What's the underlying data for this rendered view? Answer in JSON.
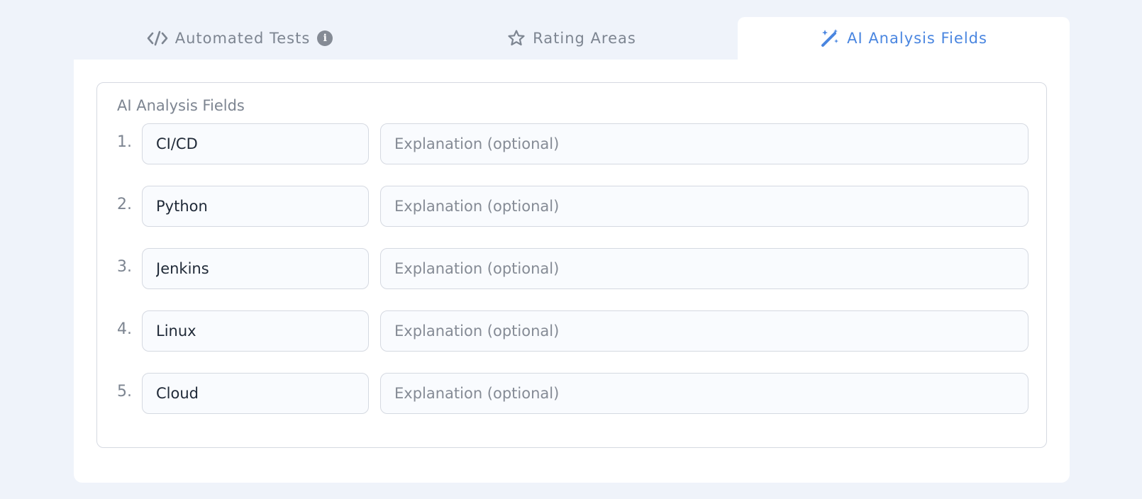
{
  "tabs": [
    {
      "label": "Automated Tests",
      "icon": "code-icon",
      "info_icon": "info-icon",
      "info_glyph": "i",
      "active": false
    },
    {
      "label": "Rating Areas",
      "icon": "star-icon",
      "active": false
    },
    {
      "label": "AI Analysis Fields",
      "icon": "magic-wand-icon",
      "active": true
    }
  ],
  "panel": {
    "legend": "AI Analysis Fields",
    "fields": [
      {
        "number": "1.",
        "value": "CI/CD",
        "placeholder": "Explanation (optional)"
      },
      {
        "number": "2.",
        "value": "Python",
        "placeholder": "Explanation (optional)"
      },
      {
        "number": "3.",
        "value": "Jenkins",
        "placeholder": "Explanation (optional)"
      },
      {
        "number": "4.",
        "value": "Linux",
        "placeholder": "Explanation (optional)"
      },
      {
        "number": "5.",
        "value": "Cloud",
        "placeholder": "Explanation (optional)"
      }
    ]
  },
  "colors": {
    "background": "#eff3fa",
    "active_tab_text": "#4a86e0",
    "inactive_tab_text": "#7d8591",
    "input_bg": "#f9fbfe",
    "border": "#d5d9e1"
  }
}
